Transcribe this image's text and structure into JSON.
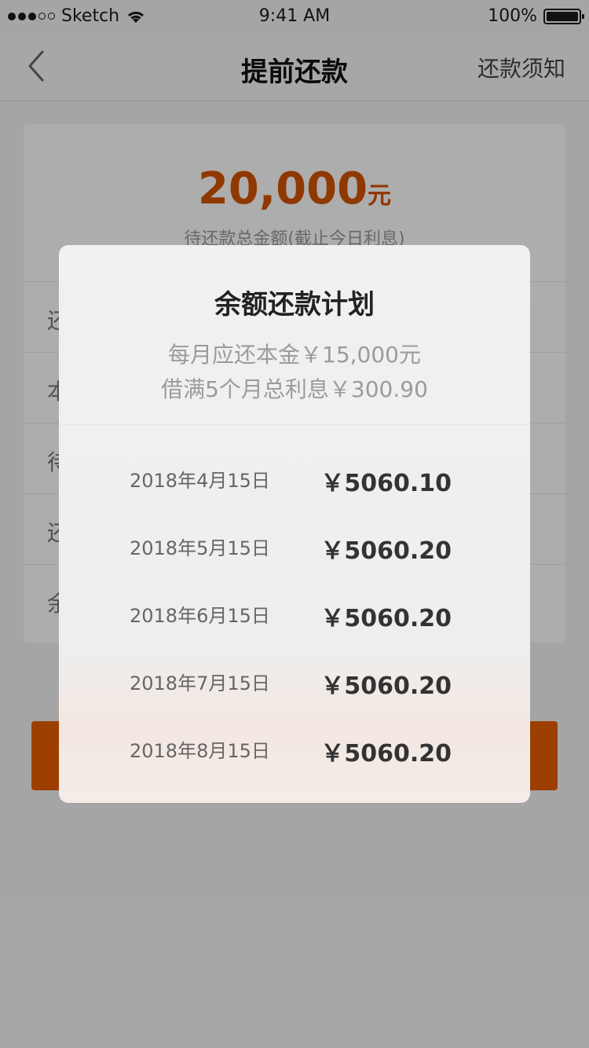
{
  "status_bar": {
    "carrier": "Sketch",
    "time": "9:41 AM",
    "battery": "100%"
  },
  "nav": {
    "title": "提前还款",
    "right_label": "还款须知"
  },
  "summary": {
    "amount": "20,000",
    "unit": "元",
    "desc": "待还款总金额(截止今日利息)",
    "rows": [
      "还",
      "本",
      "待",
      "还",
      "余"
    ]
  },
  "modal": {
    "title": "余额还款计划",
    "subtitle1": "每月应还本金￥15,000元",
    "subtitle2": "借满5个月总利息￥300.90",
    "schedule": [
      {
        "date": "2018年4月15日",
        "amount": "￥5060.10"
      },
      {
        "date": "2018年5月15日",
        "amount": "￥5060.20"
      },
      {
        "date": "2018年6月15日",
        "amount": "￥5060.20"
      },
      {
        "date": "2018年7月15日",
        "amount": "￥5060.20"
      },
      {
        "date": "2018年8月15日",
        "amount": "￥5060.20"
      }
    ]
  },
  "colors": {
    "accent": "#d35400",
    "overlay": "#000000"
  }
}
